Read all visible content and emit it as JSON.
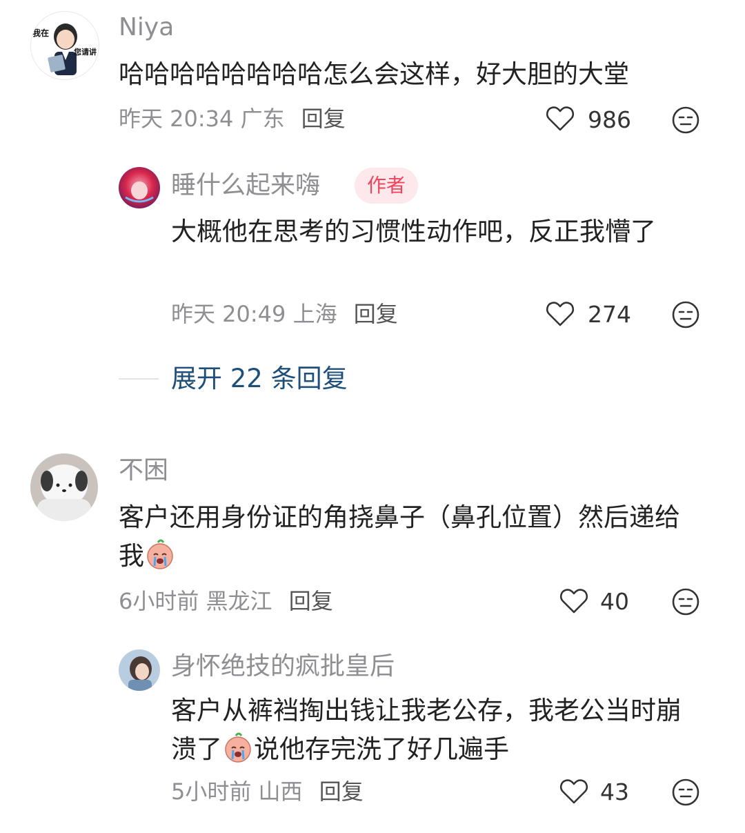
{
  "comments": [
    {
      "name": "Niya",
      "text": "哈哈哈哈哈哈哈哈怎么会这样，好大胆的大堂",
      "time": "昨天 20:34",
      "location": "广东",
      "reply_label": "回复",
      "likes": "986",
      "reply": {
        "name": "睡什么起来嗨",
        "badge": "作者",
        "text": "大概他在思考的习惯性动作吧，反正我懵了",
        "time": "昨天 20:49",
        "location": "上海",
        "reply_label": "回复",
        "likes": "274"
      },
      "expand_label": "展开 22 条回复"
    },
    {
      "name": "不困",
      "text_before": "客户还用身份证的角挠鼻子（鼻孔位置）然后递给我",
      "emoji": "crying-face-emoji",
      "time": "6小时前",
      "location": "黑龙江",
      "reply_label": "回复",
      "likes": "40",
      "reply": {
        "name": "身怀绝技的疯批皇后",
        "text_before": "客户从裤裆掏出钱让我老公存，我老公当时崩溃了",
        "emoji": "crying-face-emoji",
        "text_after": "说他存完洗了好几遍手",
        "time": "5小时前",
        "location": "山西",
        "reply_label": "回复",
        "likes": "43"
      }
    }
  ],
  "avatar_badge_text": {
    "left": "我在",
    "right": "您请讲"
  },
  "colors": {
    "name": "#8e8e93",
    "text": "#222222",
    "author_badge_bg": "#fde8ec",
    "author_badge_text": "#f0445b",
    "expand_link": "#1e4f7a"
  },
  "icons": {
    "like": "heart-outline-icon",
    "dislike": "meh-face-icon"
  }
}
